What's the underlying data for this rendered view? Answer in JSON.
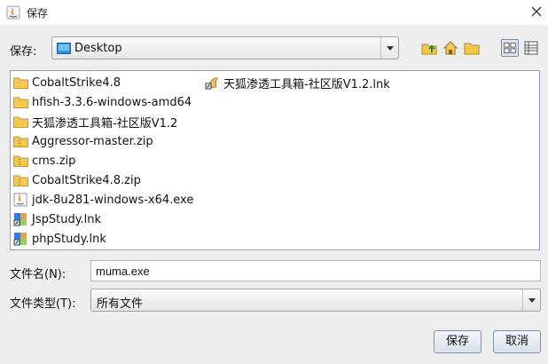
{
  "window": {
    "title": "保存"
  },
  "save_in": {
    "label": "保存:",
    "value": "Desktop"
  },
  "files": [
    {
      "name": "CobaltStrike4.8",
      "icon": "folder-icon"
    },
    {
      "name": "hfish-3.3.6-windows-amd64",
      "icon": "folder-icon"
    },
    {
      "name": "天狐渗透工具箱-社区版V1.2",
      "icon": "folder-icon"
    },
    {
      "name": "Aggressor-master.zip",
      "icon": "zip-folder-icon"
    },
    {
      "name": "cms.zip",
      "icon": "zip-folder-icon"
    },
    {
      "name": "CobaltStrike4.8.zip",
      "icon": "zip-folder-icon"
    },
    {
      "name": "jdk-8u281-windows-x64.exe",
      "icon": "java-exe-icon"
    },
    {
      "name": "JspStudy.lnk",
      "icon": "shortcut-icon"
    },
    {
      "name": "phpStudy.lnk",
      "icon": "shortcut-icon"
    },
    {
      "name": "天狐渗透工具箱-社区版V1.2.lnk",
      "icon": "fox-shortcut-icon"
    }
  ],
  "filename": {
    "label": "文件名(N):",
    "value": "muma.exe"
  },
  "filetype": {
    "label": "文件类型(T):",
    "value": "所有文件"
  },
  "buttons": {
    "save": "保存",
    "cancel": "取消"
  }
}
